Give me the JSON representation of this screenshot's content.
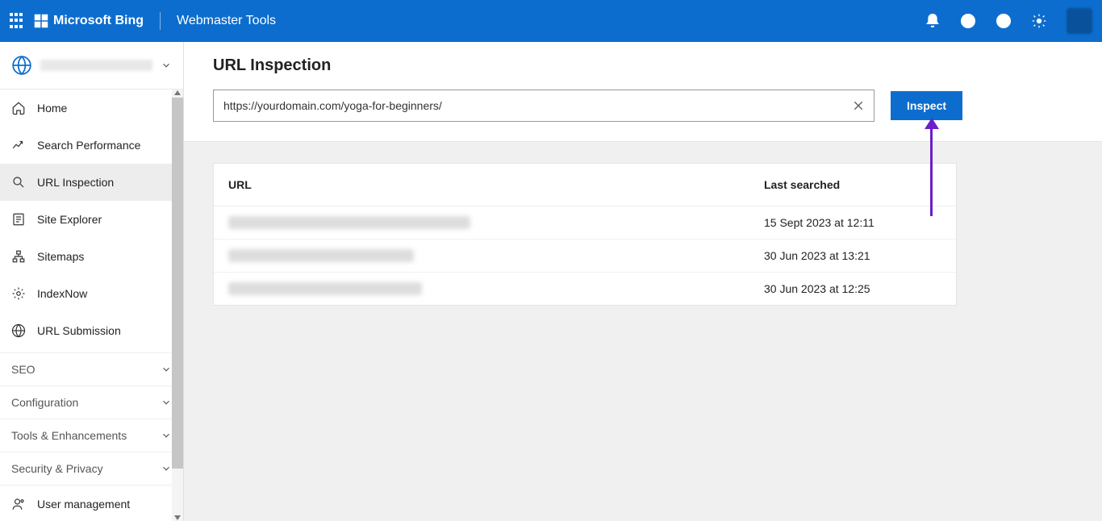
{
  "header": {
    "brand": "Microsoft Bing",
    "product": "Webmaster Tools"
  },
  "sidebar": {
    "items": [
      {
        "label": "Home"
      },
      {
        "label": "Search Performance"
      },
      {
        "label": "URL Inspection"
      },
      {
        "label": "Site Explorer"
      },
      {
        "label": "Sitemaps"
      },
      {
        "label": "IndexNow"
      },
      {
        "label": "URL Submission"
      }
    ],
    "groups": [
      {
        "label": "SEO"
      },
      {
        "label": "Configuration"
      },
      {
        "label": "Tools & Enhancements"
      },
      {
        "label": "Security & Privacy"
      }
    ],
    "footer": {
      "label": "User management"
    }
  },
  "page": {
    "title": "URL Inspection",
    "input_value": "https://yourdomain.com/yoga-for-beginners/",
    "inspect_label": "Inspect"
  },
  "table": {
    "col_url": "URL",
    "col_date": "Last searched",
    "rows": [
      {
        "date": "15 Sept 2023 at 12:11"
      },
      {
        "date": "30 Jun 2023 at 13:21"
      },
      {
        "date": "30 Jun 2023 at 12:25"
      }
    ]
  }
}
